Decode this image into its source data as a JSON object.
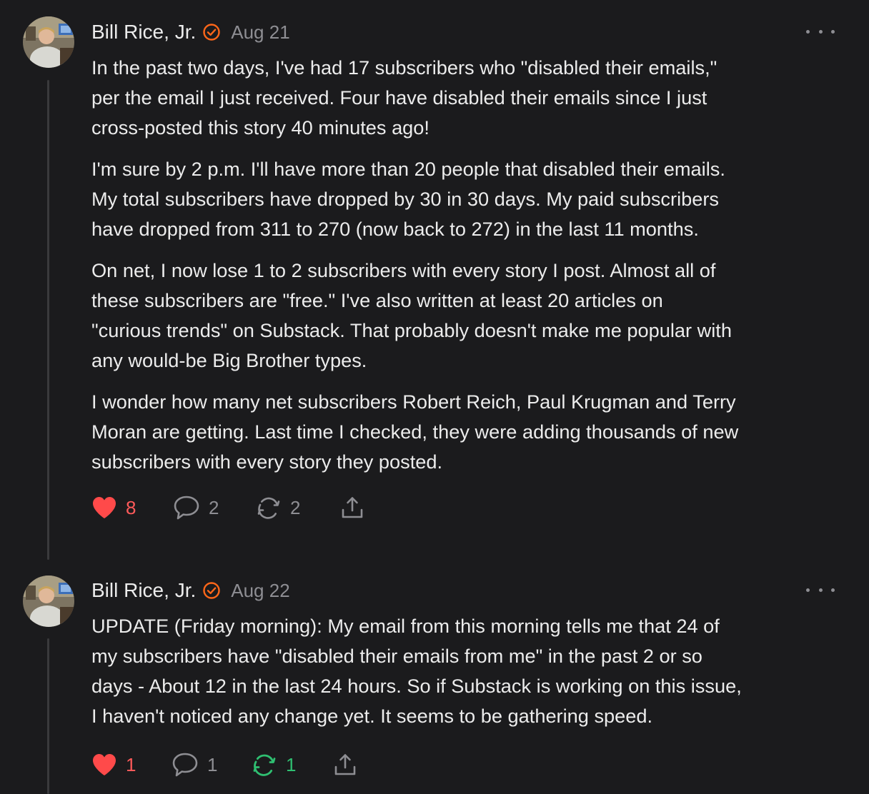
{
  "comments": [
    {
      "author": "Bill Rice, Jr.",
      "date": "Aug 21",
      "paragraphs": [
        [
          "In the past two days, I've had 17 subscribers who \"disabled their emails,\"",
          "per the email I just received. Four have disabled their emails since I just",
          "cross-posted this story 40 minutes ago!"
        ],
        [
          "I'm sure by 2 p.m. I'll have more than 20 people that disabled their emails.",
          "My total subscribers have dropped by 30 in 30 days. My paid subscribers",
          "have dropped from 311 to 270 (now back to 272) in the last 11 months."
        ],
        [
          "On net, I now lose 1 to 2 subscribers with every story I post. Almost all of",
          "these subscribers are \"free.\" I've also written at least 20 articles on",
          "\"curious trends\" on Substack. That probably doesn't make me popular with",
          "any would-be Big Brother types."
        ],
        [
          "I wonder how many net subscribers Robert Reich, Paul Krugman and Terry",
          "Moran are getting. Last time I checked, they were adding thousands of new",
          "subscribers with every story they posted."
        ]
      ],
      "likes": "8",
      "replies": "2",
      "restacks": "2",
      "liked": true,
      "restacked": false
    },
    {
      "author": "Bill Rice, Jr.",
      "date": "Aug 22",
      "paragraphs": [
        [
          "UPDATE (Friday morning): My email from this morning tells me that 24 of",
          "my subscribers have \"disabled their emails from me\" in the past 2 or so",
          "days - About 12 in the last 24 hours. So if Substack is working on this issue,",
          "I haven't noticed any change yet. It seems to be gathering speed."
        ]
      ],
      "likes": "1",
      "replies": "1",
      "restacks": "1",
      "liked": true,
      "restacked": true
    }
  ],
  "colors": {
    "background": "#1b1b1d",
    "text": "#ececec",
    "muted": "#8e8e93",
    "like": "#ff4a4a",
    "restack_active": "#2fbf71",
    "badge": "#ff6719"
  },
  "icons": [
    "avatar",
    "verified-badge-icon",
    "more-options-icon",
    "heart-icon",
    "comment-icon",
    "restack-icon",
    "share-icon"
  ]
}
